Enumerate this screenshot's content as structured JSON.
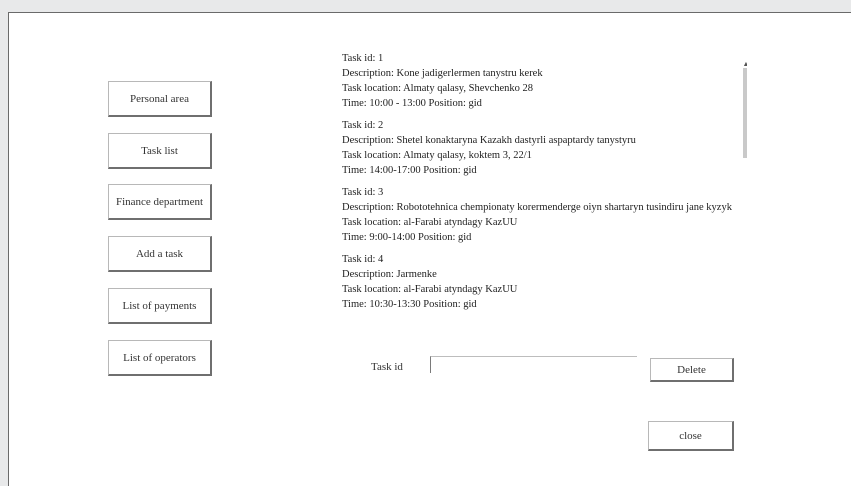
{
  "nav": {
    "items": [
      {
        "label": "Personal area"
      },
      {
        "label": "Task list"
      },
      {
        "label": "Finance department"
      },
      {
        "label": "Add a task"
      },
      {
        "label": "List of payments"
      },
      {
        "label": "List of operators"
      }
    ]
  },
  "tasks": [
    {
      "id": "Task id: 1",
      "description": "Description: Kone jadigerlermen tanystru kerek",
      "location": "Task location: Almaty qalasy, Shevchenko 28",
      "time": "Time: 10:00 - 13:00 Position: gid"
    },
    {
      "id": "Task id: 2",
      "description": "Description: Shetel konaktaryna Kazakh dastyrli aspaptardy tanystyru",
      "location": "Task location: Almaty qalasy, koktem 3, 22/1",
      "time": "Time: 14:00-17:00  Position: gid"
    },
    {
      "id": "Task id: 3",
      "description": "Description: Robototehnica chempionaty korermenderge oiyn shartaryn tusindiru jane kyzyk",
      "location": "Task location: al-Farabi atyndagy KazUU",
      "time": "Time: 9:00-14:00    Position: gid"
    },
    {
      "id": "Task id: 4",
      "description": "Description: Jarmenke",
      "location": "Task location: al-Farabi atyndagy KazUU",
      "time": "Time: 10:30-13:30  Position: gid"
    }
  ],
  "task_id_field": {
    "label": "Task id",
    "value": ""
  },
  "buttons": {
    "delete": "Delete",
    "close": "close"
  },
  "scrollbar": {
    "up_icon": "▲",
    "down_icon": "▼"
  }
}
